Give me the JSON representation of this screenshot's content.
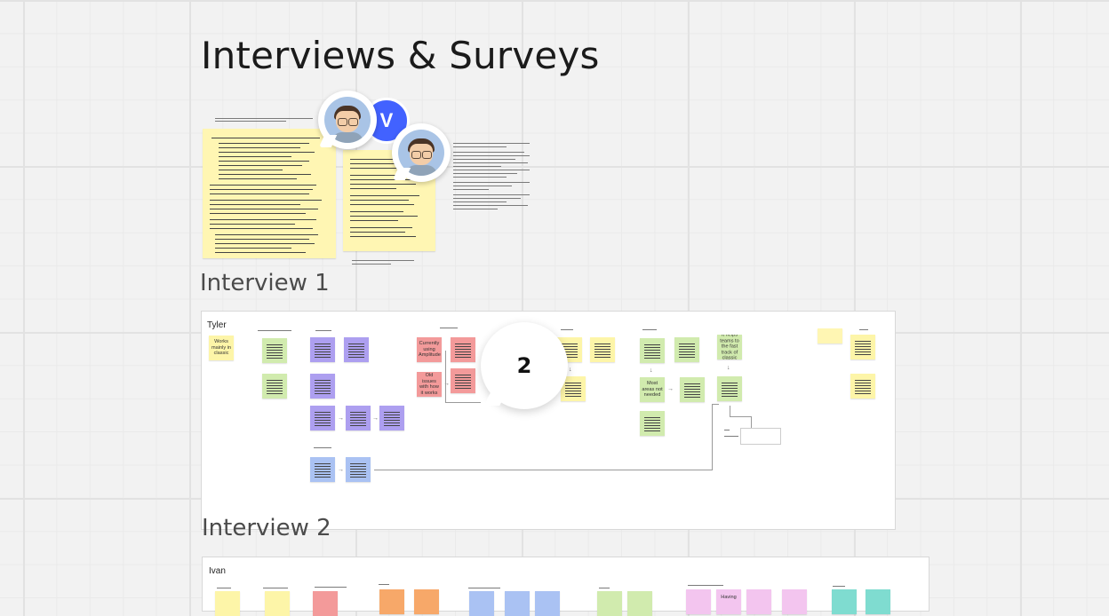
{
  "board": {
    "title": "Interviews & Surveys",
    "sections": [
      {
        "title": "Interview 1",
        "participant": "Tyler"
      },
      {
        "title": "Interview 2",
        "participant": "Ivan"
      }
    ]
  },
  "collaborators": {
    "initial": "V",
    "count_badge": "2"
  },
  "interview1_notes": {
    "works_mainly": "Works mainly in classic",
    "currently_using": "Currently using Amplitude",
    "old_issues": "Old issues with how it works",
    "most_areas": "Most areas not needed",
    "it_helps": "It helps teams to the fast track of classic"
  },
  "interview2_notes": {
    "having": "Having"
  },
  "colors": {
    "accent": "#4262ff",
    "sticky_yellow": "#fdf5a8",
    "sticky_green": "#d1ebae",
    "sticky_purple": "#ad9ff0",
    "sticky_blue": "#aac2f3",
    "sticky_red": "#f39a9a"
  }
}
